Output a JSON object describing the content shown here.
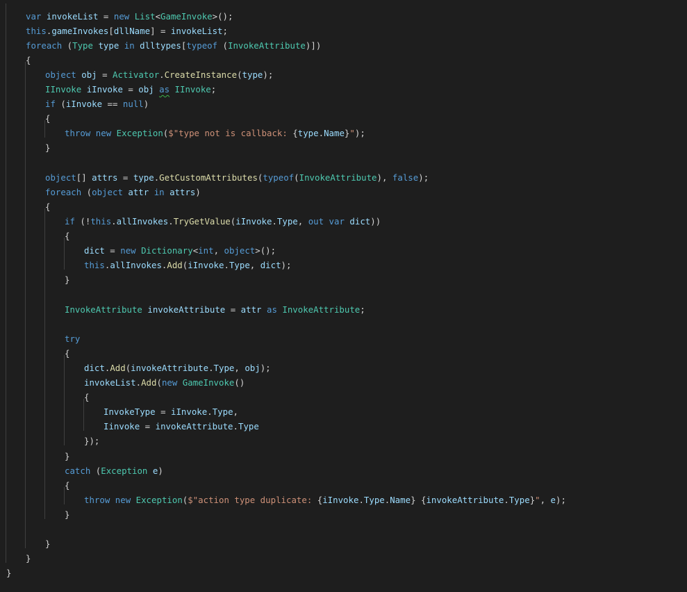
{
  "editor": {
    "language": "csharp",
    "colors": {
      "background": "#1e1e1e",
      "keyword": "#569cd6",
      "type": "#4ec9b0",
      "method": "#dcdcaa",
      "string": "#ce9178",
      "variable": "#9cdcfe",
      "plain": "#d4d4d4",
      "indent_guide": "#404040",
      "warning_squiggle": "#3bb34a"
    },
    "lines": [
      {
        "indent": 1,
        "tokens": [
          [
            "kw",
            "var"
          ],
          [
            "pl",
            " "
          ],
          [
            "var",
            "invokeList"
          ],
          [
            "pl",
            " = "
          ],
          [
            "kw",
            "new"
          ],
          [
            "pl",
            " "
          ],
          [
            "ty",
            "List"
          ],
          [
            "pn",
            "<"
          ],
          [
            "ty",
            "GameInvoke"
          ],
          [
            "pn",
            ">();"
          ]
        ]
      },
      {
        "indent": 1,
        "tokens": [
          [
            "kw",
            "this"
          ],
          [
            "pn",
            "."
          ],
          [
            "var",
            "gameInvokes"
          ],
          [
            "pn",
            "["
          ],
          [
            "var",
            "dllName"
          ],
          [
            "pn",
            "] = "
          ],
          [
            "var",
            "invokeList"
          ],
          [
            "pn",
            ";"
          ]
        ]
      },
      {
        "indent": 1,
        "tokens": [
          [
            "kw",
            "foreach"
          ],
          [
            "pn",
            " ("
          ],
          [
            "ty",
            "Type"
          ],
          [
            "pl",
            " "
          ],
          [
            "var",
            "type"
          ],
          [
            "pl",
            " "
          ],
          [
            "kw",
            "in"
          ],
          [
            "pl",
            " "
          ],
          [
            "var",
            "dlltypes"
          ],
          [
            "pn",
            "["
          ],
          [
            "kw",
            "typeof"
          ],
          [
            "pn",
            " ("
          ],
          [
            "ty",
            "InvokeAttribute"
          ],
          [
            "pn",
            ")])"
          ]
        ]
      },
      {
        "indent": 1,
        "tokens": [
          [
            "pn",
            "{"
          ]
        ]
      },
      {
        "indent": 2,
        "tokens": [
          [
            "kw",
            "object"
          ],
          [
            "pl",
            " "
          ],
          [
            "var",
            "obj"
          ],
          [
            "pl",
            " = "
          ],
          [
            "ty",
            "Activator"
          ],
          [
            "pn",
            "."
          ],
          [
            "fn",
            "CreateInstance"
          ],
          [
            "pn",
            "("
          ],
          [
            "var",
            "type"
          ],
          [
            "pn",
            ");"
          ]
        ]
      },
      {
        "indent": 2,
        "tokens": [
          [
            "ty",
            "IInvoke"
          ],
          [
            "pl",
            " "
          ],
          [
            "var",
            "iInvoke"
          ],
          [
            "pl",
            " = "
          ],
          [
            "var",
            "obj"
          ],
          [
            "pl",
            " "
          ],
          [
            "kw",
            "as",
            "squiggle"
          ],
          [
            "pl",
            " "
          ],
          [
            "ty",
            "IInvoke"
          ],
          [
            "pn",
            ";"
          ]
        ]
      },
      {
        "indent": 2,
        "tokens": [
          [
            "kw",
            "if"
          ],
          [
            "pn",
            " ("
          ],
          [
            "var",
            "iInvoke"
          ],
          [
            "pl",
            " == "
          ],
          [
            "kw",
            "null"
          ],
          [
            "pn",
            ")"
          ]
        ]
      },
      {
        "indent": 2,
        "tokens": [
          [
            "pn",
            "{"
          ]
        ]
      },
      {
        "indent": 3,
        "tokens": [
          [
            "kw",
            "throw"
          ],
          [
            "pl",
            " "
          ],
          [
            "kw",
            "new"
          ],
          [
            "pl",
            " "
          ],
          [
            "ty",
            "Exception"
          ],
          [
            "pn",
            "("
          ],
          [
            "str",
            "$\"type not is callback: "
          ],
          [
            "pn",
            "{"
          ],
          [
            "var",
            "type"
          ],
          [
            "pn",
            "."
          ],
          [
            "var",
            "Name"
          ],
          [
            "pn",
            "}"
          ],
          [
            "str",
            "\""
          ],
          [
            "pn",
            ");"
          ]
        ]
      },
      {
        "indent": 2,
        "tokens": [
          [
            "pn",
            "}"
          ]
        ]
      },
      {
        "indent": 0,
        "tokens": []
      },
      {
        "indent": 2,
        "tokens": [
          [
            "kw",
            "object"
          ],
          [
            "pn",
            "[]"
          ],
          [
            "pl",
            " "
          ],
          [
            "var",
            "attrs"
          ],
          [
            "pl",
            " = "
          ],
          [
            "var",
            "type"
          ],
          [
            "pn",
            "."
          ],
          [
            "fn",
            "GetCustomAttributes"
          ],
          [
            "pn",
            "("
          ],
          [
            "kw",
            "typeof"
          ],
          [
            "pn",
            "("
          ],
          [
            "ty",
            "InvokeAttribute"
          ],
          [
            "pn",
            "), "
          ],
          [
            "kw",
            "false"
          ],
          [
            "pn",
            ");"
          ]
        ]
      },
      {
        "indent": 2,
        "tokens": [
          [
            "kw",
            "foreach"
          ],
          [
            "pn",
            " ("
          ],
          [
            "kw",
            "object"
          ],
          [
            "pl",
            " "
          ],
          [
            "var",
            "attr"
          ],
          [
            "pl",
            " "
          ],
          [
            "kw",
            "in"
          ],
          [
            "pl",
            " "
          ],
          [
            "var",
            "attrs"
          ],
          [
            "pn",
            ")"
          ]
        ]
      },
      {
        "indent": 2,
        "tokens": [
          [
            "pn",
            "{"
          ]
        ]
      },
      {
        "indent": 3,
        "tokens": [
          [
            "kw",
            "if"
          ],
          [
            "pn",
            " (!"
          ],
          [
            "kw",
            "this"
          ],
          [
            "pn",
            "."
          ],
          [
            "var",
            "allInvokes"
          ],
          [
            "pn",
            "."
          ],
          [
            "fn",
            "TryGetValue"
          ],
          [
            "pn",
            "("
          ],
          [
            "var",
            "iInvoke"
          ],
          [
            "pn",
            "."
          ],
          [
            "var",
            "Type"
          ],
          [
            "pn",
            ", "
          ],
          [
            "kw",
            "out"
          ],
          [
            "pl",
            " "
          ],
          [
            "kw",
            "var"
          ],
          [
            "pl",
            " "
          ],
          [
            "var",
            "dict"
          ],
          [
            "pn",
            "))"
          ]
        ]
      },
      {
        "indent": 3,
        "tokens": [
          [
            "pn",
            "{"
          ]
        ]
      },
      {
        "indent": 4,
        "tokens": [
          [
            "var",
            "dict"
          ],
          [
            "pl",
            " = "
          ],
          [
            "kw",
            "new"
          ],
          [
            "pl",
            " "
          ],
          [
            "ty",
            "Dictionary"
          ],
          [
            "pn",
            "<"
          ],
          [
            "kw",
            "int"
          ],
          [
            "pn",
            ", "
          ],
          [
            "kw",
            "object"
          ],
          [
            "pn",
            ">();"
          ]
        ]
      },
      {
        "indent": 4,
        "tokens": [
          [
            "kw",
            "this"
          ],
          [
            "pn",
            "."
          ],
          [
            "var",
            "allInvokes"
          ],
          [
            "pn",
            "."
          ],
          [
            "fn",
            "Add"
          ],
          [
            "pn",
            "("
          ],
          [
            "var",
            "iInvoke"
          ],
          [
            "pn",
            "."
          ],
          [
            "var",
            "Type"
          ],
          [
            "pn",
            ", "
          ],
          [
            "var",
            "dict"
          ],
          [
            "pn",
            ");"
          ]
        ]
      },
      {
        "indent": 3,
        "tokens": [
          [
            "pn",
            "}"
          ]
        ]
      },
      {
        "indent": 0,
        "tokens": []
      },
      {
        "indent": 3,
        "tokens": [
          [
            "ty",
            "InvokeAttribute"
          ],
          [
            "pl",
            " "
          ],
          [
            "var",
            "invokeAttribute"
          ],
          [
            "pl",
            " = "
          ],
          [
            "var",
            "attr"
          ],
          [
            "pl",
            " "
          ],
          [
            "kw",
            "as"
          ],
          [
            "pl",
            " "
          ],
          [
            "ty",
            "InvokeAttribute"
          ],
          [
            "pn",
            ";"
          ]
        ]
      },
      {
        "indent": 0,
        "tokens": []
      },
      {
        "indent": 3,
        "tokens": [
          [
            "kw",
            "try"
          ]
        ]
      },
      {
        "indent": 3,
        "tokens": [
          [
            "pn",
            "{"
          ]
        ]
      },
      {
        "indent": 4,
        "tokens": [
          [
            "var",
            "dict"
          ],
          [
            "pn",
            "."
          ],
          [
            "fn",
            "Add"
          ],
          [
            "pn",
            "("
          ],
          [
            "var",
            "invokeAttribute"
          ],
          [
            "pn",
            "."
          ],
          [
            "var",
            "Type"
          ],
          [
            "pn",
            ", "
          ],
          [
            "var",
            "obj"
          ],
          [
            "pn",
            ");"
          ]
        ]
      },
      {
        "indent": 4,
        "tokens": [
          [
            "var",
            "invokeList"
          ],
          [
            "pn",
            "."
          ],
          [
            "fn",
            "Add"
          ],
          [
            "pn",
            "("
          ],
          [
            "kw",
            "new"
          ],
          [
            "pl",
            " "
          ],
          [
            "ty",
            "GameInvoke"
          ],
          [
            "pn",
            "()"
          ]
        ]
      },
      {
        "indent": 4,
        "tokens": [
          [
            "pn",
            "{"
          ]
        ]
      },
      {
        "indent": 5,
        "tokens": [
          [
            "var",
            "InvokeType"
          ],
          [
            "pl",
            " = "
          ],
          [
            "var",
            "iInvoke"
          ],
          [
            "pn",
            "."
          ],
          [
            "var",
            "Type"
          ],
          [
            "pn",
            ","
          ]
        ]
      },
      {
        "indent": 5,
        "tokens": [
          [
            "var",
            "Iinvoke"
          ],
          [
            "pl",
            " = "
          ],
          [
            "var",
            "invokeAttribute"
          ],
          [
            "pn",
            "."
          ],
          [
            "var",
            "Type"
          ]
        ]
      },
      {
        "indent": 4,
        "tokens": [
          [
            "pn",
            "});"
          ]
        ]
      },
      {
        "indent": 3,
        "tokens": [
          [
            "pn",
            "}"
          ]
        ]
      },
      {
        "indent": 3,
        "tokens": [
          [
            "kw",
            "catch"
          ],
          [
            "pn",
            " ("
          ],
          [
            "ty",
            "Exception"
          ],
          [
            "pl",
            " "
          ],
          [
            "var",
            "e"
          ],
          [
            "pn",
            ")"
          ]
        ]
      },
      {
        "indent": 3,
        "tokens": [
          [
            "pn",
            "{"
          ]
        ]
      },
      {
        "indent": 4,
        "tokens": [
          [
            "kw",
            "throw"
          ],
          [
            "pl",
            " "
          ],
          [
            "kw",
            "new"
          ],
          [
            "pl",
            " "
          ],
          [
            "ty",
            "Exception"
          ],
          [
            "pn",
            "("
          ],
          [
            "str",
            "$\"action type duplicate: "
          ],
          [
            "pn",
            "{"
          ],
          [
            "var",
            "iInvoke"
          ],
          [
            "pn",
            "."
          ],
          [
            "var",
            "Type"
          ],
          [
            "pn",
            "."
          ],
          [
            "var",
            "Name"
          ],
          [
            "pn",
            "}"
          ],
          [
            "str",
            " "
          ],
          [
            "pn",
            "{"
          ],
          [
            "var",
            "invokeAttribute"
          ],
          [
            "pn",
            "."
          ],
          [
            "var",
            "Type"
          ],
          [
            "pn",
            "}"
          ],
          [
            "str",
            "\""
          ],
          [
            "pn",
            ", "
          ],
          [
            "var",
            "e"
          ],
          [
            "pn",
            ");"
          ]
        ]
      },
      {
        "indent": 3,
        "tokens": [
          [
            "pn",
            "}"
          ]
        ]
      },
      {
        "indent": 0,
        "tokens": []
      },
      {
        "indent": 2,
        "tokens": [
          [
            "pn",
            "}"
          ]
        ]
      },
      {
        "indent": 1,
        "tokens": [
          [
            "pn",
            "}"
          ]
        ]
      },
      {
        "indent": 0,
        "tokens": [
          [
            "pn",
            "}"
          ]
        ]
      }
    ]
  }
}
